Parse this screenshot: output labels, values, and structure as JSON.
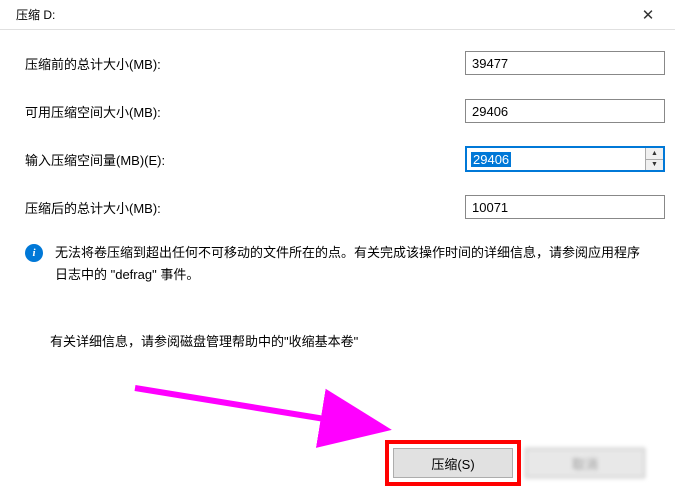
{
  "dialog": {
    "title": "压缩 D:"
  },
  "form": {
    "label_before_total": "压缩前的总计大小(MB):",
    "value_before_total": "39477",
    "label_available": "可用压缩空间大小(MB):",
    "value_available": "29406",
    "label_input_shrink": "输入压缩空间量(MB)(E):",
    "value_input_shrink": "29406",
    "label_after_total": "压缩后的总计大小(MB):",
    "value_after_total": "10071"
  },
  "info": {
    "text": "无法将卷压缩到超出任何不可移动的文件所在的点。有关完成该操作时间的详细信息，请参阅应用程序日志中的 \"defrag\" 事件。"
  },
  "detail": {
    "text": "有关详细信息，请参阅磁盘管理帮助中的\"收缩基本卷\""
  },
  "buttons": {
    "shrink": "压缩(S)",
    "cancel": "取消"
  }
}
